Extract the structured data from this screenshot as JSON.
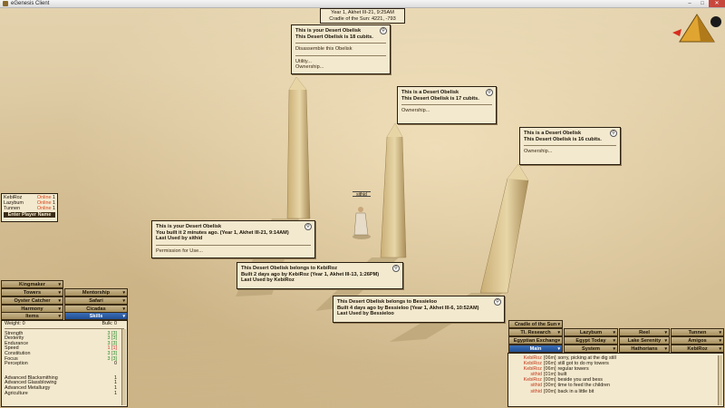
{
  "window": {
    "title": "eGenesis Client"
  },
  "date": {
    "line1": "Year 1, Akhet III-21, 9:25AM",
    "line2": "Cradle of the Sun: 4221, -793"
  },
  "popups": {
    "obelisk_mine_top": {
      "line1": "This is your Desert Obelisk",
      "line2": "This Desert Obelisk is 18 cubits.",
      "opt1": "Disassemble this Obelisk",
      "opt2": "Utility...",
      "opt3": "Ownership..."
    },
    "obelisk_17": {
      "line1": "This is a Desert Obelisk",
      "line2": "This Desert Obelisk is 17 cubits.",
      "opt1": "Ownership..."
    },
    "obelisk_16": {
      "line1": "This is a Desert Obelisk",
      "line2": "This Desert Obelisk is 16 cubits.",
      "opt1": "Ownership..."
    },
    "obelisk_built": {
      "line1": "This is your Desert Obelisk",
      "line2": "You built it 2 minutes ago. (Year 1, Akhet III-21, 9:14AM)",
      "line3": "Last Used by sithid",
      "opt1": "Permission for Use..."
    },
    "obelisk_kebi": {
      "line1": "This Desert Obelisk belongs to KebiRoz",
      "line2": "Built 2 days ago by KebiRoz (Year 1, Akhet III-13, 1:26PM)",
      "line3": "Last Used by KebiRoz"
    },
    "obelisk_bessi": {
      "line1": "This Desert Obelisk belongs to Bessieloo",
      "line2": "Built 4 days ago by Bessieloo (Year 1, Akhet III-6, 10:52AM)",
      "line3": "Last Used by Bessieloo"
    }
  },
  "player_name": "sithid",
  "players": {
    "rows": [
      {
        "name": "KebiRoz",
        "status": "Online",
        "num": "1"
      },
      {
        "name": "Lazybum",
        "status": "Online",
        "num": "1"
      },
      {
        "name": "Tunnen",
        "status": "Online",
        "num": "1"
      }
    ],
    "enter_label": "Enter Player Name"
  },
  "left_tabs": {
    "kingmaker": "Kingmaker",
    "towers": "Towers",
    "mentorship": "Mentorship",
    "oyster": "Oyster Catcher",
    "safari": "Safari",
    "harmony": "Harmony",
    "cicadas": "Cicadas",
    "items": "Items",
    "skills": "Skills"
  },
  "stats": {
    "weight_label": "Weight: 0",
    "bulk_label": "Bulk: 0",
    "rows": [
      {
        "name": "Strength",
        "val": "3 [3]"
      },
      {
        "name": "Dexterity",
        "val": "3 [3]"
      },
      {
        "name": "Endurance",
        "val": "3 [3]"
      },
      {
        "name": "Speed",
        "val": "1 [1]"
      },
      {
        "name": "Constitution",
        "val": "3 [3]"
      },
      {
        "name": "Focus",
        "val": "3 [3]"
      },
      {
        "name": "Perception",
        "val": "0"
      }
    ],
    "skills": [
      {
        "name": "Advanced Blacksmithing",
        "val": "1"
      },
      {
        "name": "Advanced Glassblowing",
        "val": "1"
      },
      {
        "name": "Advanced Metallurgy",
        "val": "1"
      },
      {
        "name": "Agriculture",
        "val": "1"
      }
    ]
  },
  "chat_tabs": {
    "cradle": "Cradle of the Sun",
    "research": "Tl. Research",
    "lazybum": "Lazybum",
    "reel": "Reel",
    "tunnen": "Tunnen",
    "egyptian_exch": "Egyptian Exchang",
    "egypt_today": "Egypt Today",
    "lake": "Lake Serenity",
    "amigos": "Amigos",
    "main": "Main",
    "system": "System",
    "hathorians": "Hathorians",
    "kebiroz": "KebiRoz"
  },
  "chat": [
    {
      "name": "KebiRoz",
      "time": "[06m]",
      "msg": "sorry, picking at the dig still"
    },
    {
      "name": "KebiRoz",
      "time": "[06m]",
      "msg": "still got to do my towers"
    },
    {
      "name": "KebiRoz",
      "time": "[06m]",
      "msg": "regular towers"
    },
    {
      "name": "sithid",
      "time": "[01m]",
      "msg": "built"
    },
    {
      "name": "KebiRoz",
      "time": "[00m]",
      "msg": "beside you and bess"
    },
    {
      "name": "sithid",
      "time": "[00m]",
      "msg": "time to feed the children"
    },
    {
      "name": "sithid",
      "time": "[00m]",
      "msg": "back in a little bit"
    }
  ]
}
